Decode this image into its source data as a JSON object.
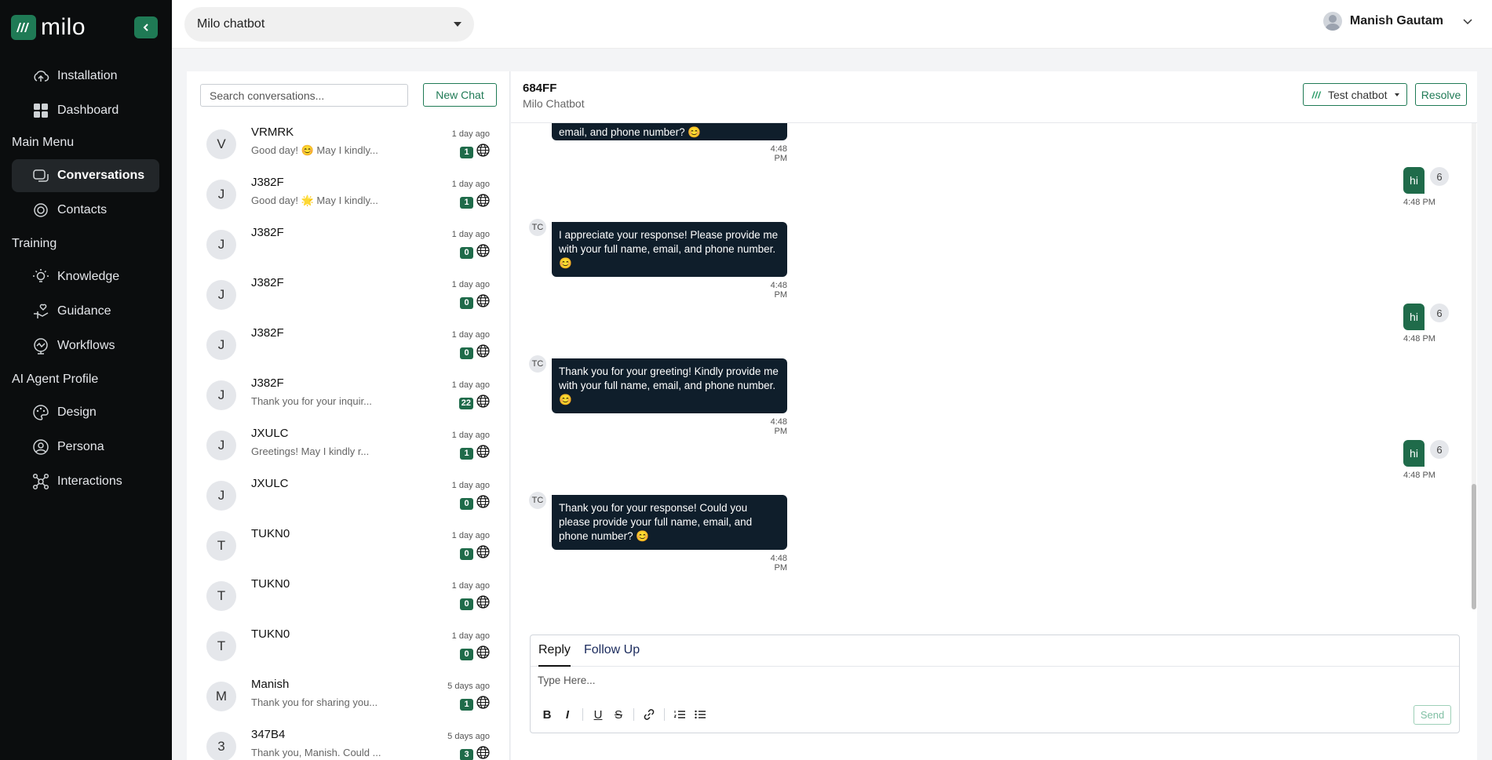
{
  "brand": {
    "name": "milo"
  },
  "sidebar": {
    "items_top": [
      {
        "label": "Installation",
        "icon": "cloud-upload-icon"
      },
      {
        "label": "Dashboard",
        "icon": "dashboard-grid-icon"
      }
    ],
    "section_main": "Main Menu",
    "items_main": [
      {
        "label": "Conversations",
        "icon": "chat-icon",
        "active": true
      },
      {
        "label": "Contacts",
        "icon": "target-icon"
      }
    ],
    "section_training": "Training",
    "items_training": [
      {
        "label": "Knowledge",
        "icon": "lightbulb-icon"
      },
      {
        "label": "Guidance",
        "icon": "hand-heart-icon"
      },
      {
        "label": "Workflows",
        "icon": "workflow-icon"
      }
    ],
    "section_agent": "AI Agent Profile",
    "items_agent": [
      {
        "label": "Design",
        "icon": "palette-icon"
      },
      {
        "label": "Persona",
        "icon": "persona-icon"
      },
      {
        "label": "Interactions",
        "icon": "interactions-icon"
      }
    ]
  },
  "topbar": {
    "bot_selected": "Milo chatbot",
    "user_name": "Manish Gautam"
  },
  "list": {
    "search_placeholder": "Search conversations...",
    "new_chat_label": "New Chat",
    "conversations": [
      {
        "initial": "V",
        "name": "VRMRK",
        "preview": "Good day! 😊 May I kindly...",
        "time": "1 day ago",
        "count": "1"
      },
      {
        "initial": "J",
        "name": "J382F",
        "preview": "Good day! 🌟 May I kindly...",
        "time": "1 day ago",
        "count": "1"
      },
      {
        "initial": "J",
        "name": "J382F",
        "preview": "",
        "time": "1 day ago",
        "count": "0"
      },
      {
        "initial": "J",
        "name": "J382F",
        "preview": "",
        "time": "1 day ago",
        "count": "0"
      },
      {
        "initial": "J",
        "name": "J382F",
        "preview": "",
        "time": "1 day ago",
        "count": "0"
      },
      {
        "initial": "J",
        "name": "J382F",
        "preview": "Thank you for your inquir...",
        "time": "1 day ago",
        "count": "22"
      },
      {
        "initial": "J",
        "name": "JXULC",
        "preview": "Greetings! May I kindly r...",
        "time": "1 day ago",
        "count": "1"
      },
      {
        "initial": "J",
        "name": "JXULC",
        "preview": "",
        "time": "1 day ago",
        "count": "0"
      },
      {
        "initial": "T",
        "name": "TUKN0",
        "preview": "",
        "time": "1 day ago",
        "count": "0"
      },
      {
        "initial": "T",
        "name": "TUKN0",
        "preview": "",
        "time": "1 day ago",
        "count": "0"
      },
      {
        "initial": "T",
        "name": "TUKN0",
        "preview": "",
        "time": "1 day ago",
        "count": "0"
      },
      {
        "initial": "M",
        "name": "Manish",
        "preview": "Thank you for sharing you...",
        "time": "5 days ago",
        "count": "1"
      },
      {
        "initial": "3",
        "name": "347B4",
        "preview": "Thank you, Manish. Could ...",
        "time": "5 days ago",
        "count": "3"
      }
    ]
  },
  "chat": {
    "id": "684FF",
    "subtitle": "Milo Chatbot",
    "test_label": "Test chatbot",
    "resolve_label": "Resolve",
    "bot_initials": "TC",
    "messages": [
      {
        "from": "bot",
        "text": "email, and phone number? 😊",
        "time": "4:48 PM"
      },
      {
        "from": "user",
        "text": "hi",
        "num": "6",
        "time": "4:48 PM"
      },
      {
        "from": "bot",
        "text": "I appreciate your response! Please provide me with your full name, email, and phone number. 😊",
        "time": "4:48 PM"
      },
      {
        "from": "user",
        "text": "hi",
        "num": "6",
        "time": "4:48 PM"
      },
      {
        "from": "bot",
        "text": "Thank you for your greeting! Kindly provide me with your full name, email, and phone number. 😊",
        "time": "4:48 PM"
      },
      {
        "from": "user",
        "text": "hi",
        "num": "6",
        "time": "4:48 PM"
      },
      {
        "from": "bot",
        "text": "Thank you for your response! Could you please provide your full name, email, and phone number? 😊",
        "time": "4:48 PM"
      }
    ],
    "composer": {
      "tab_reply": "Reply",
      "tab_follow": "Follow Up",
      "placeholder": "Type Here...",
      "send_label": "Send"
    }
  },
  "colors": {
    "accent": "#1f7a55",
    "sidebar_bg": "#0b0d0e",
    "bot_bubble": "#0f1e2b",
    "user_bubble": "#1f6b4a"
  }
}
